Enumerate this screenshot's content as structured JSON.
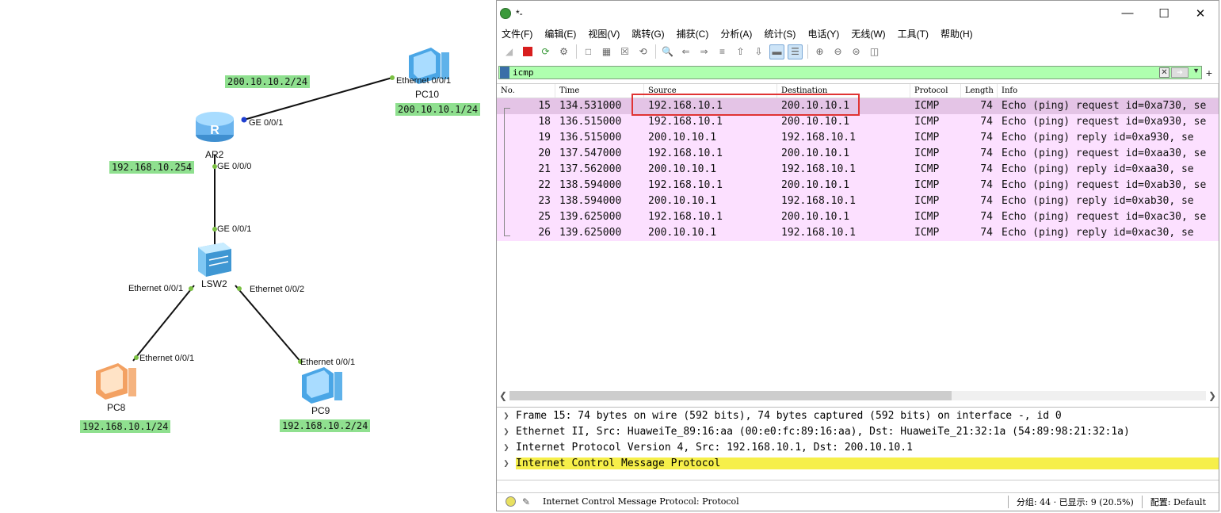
{
  "topology": {
    "ip_labels": {
      "ar2_wan": "200.10.10.2/24",
      "pc10": "200.10.10.1/24",
      "ar2_lan": "192.168.10.254",
      "pc8": "192.168.10.1/24",
      "pc9": "192.168.10.2/24"
    },
    "port_labels": {
      "pc10_eth": "Ethernet 0/0/1",
      "ar2_ge001": "GE 0/0/1",
      "ar2_ge000": "GE 0/0/0",
      "lsw2_ge001": "GE 0/0/1",
      "lsw2_eth1": "Ethernet 0/0/1",
      "lsw2_eth2": "Ethernet 0/0/2",
      "pc8_eth": "Ethernet 0/0/1",
      "pc9_eth": "Ethernet 0/0/1"
    },
    "devices": {
      "router": "AR2",
      "switch": "LSW2",
      "pc10": "PC10",
      "pc8": "PC8",
      "pc9": "PC9"
    },
    "colors": {
      "ip_label_bg": "#8fe08f",
      "link": "#111111",
      "port_dot": "#7bc043",
      "router_port_dot": "#1f3fd0"
    }
  },
  "wireshark": {
    "title": "*-",
    "menu": [
      "文件(F)",
      "编辑(E)",
      "视图(V)",
      "跳转(G)",
      "捕获(C)",
      "分析(A)",
      "统计(S)",
      "电话(Y)",
      "无线(W)",
      "工具(T)",
      "帮助(H)"
    ],
    "filter": {
      "value": "icmp"
    },
    "columns": [
      "No.",
      "Time",
      "Source",
      "Destination",
      "Protocol",
      "Length",
      "Info"
    ],
    "packets": [
      {
        "no": "15",
        "time": "134.531000",
        "src": "192.168.10.1",
        "dst": "200.10.10.1",
        "proto": "ICMP",
        "len": "74",
        "info": "Echo (ping) request  id=0xa730, se"
      },
      {
        "no": "18",
        "time": "136.515000",
        "src": "192.168.10.1",
        "dst": "200.10.10.1",
        "proto": "ICMP",
        "len": "74",
        "info": "Echo (ping) request  id=0xa930, se"
      },
      {
        "no": "19",
        "time": "136.515000",
        "src": "200.10.10.1",
        "dst": "192.168.10.1",
        "proto": "ICMP",
        "len": "74",
        "info": "Echo (ping) reply    id=0xa930, se"
      },
      {
        "no": "20",
        "time": "137.547000",
        "src": "192.168.10.1",
        "dst": "200.10.10.1",
        "proto": "ICMP",
        "len": "74",
        "info": "Echo (ping) request  id=0xaa30, se"
      },
      {
        "no": "21",
        "time": "137.562000",
        "src": "200.10.10.1",
        "dst": "192.168.10.1",
        "proto": "ICMP",
        "len": "74",
        "info": "Echo (ping) reply    id=0xaa30, se"
      },
      {
        "no": "22",
        "time": "138.594000",
        "src": "192.168.10.1",
        "dst": "200.10.10.1",
        "proto": "ICMP",
        "len": "74",
        "info": "Echo (ping) request  id=0xab30, se"
      },
      {
        "no": "23",
        "time": "138.594000",
        "src": "200.10.10.1",
        "dst": "192.168.10.1",
        "proto": "ICMP",
        "len": "74",
        "info": "Echo (ping) reply    id=0xab30, se"
      },
      {
        "no": "25",
        "time": "139.625000",
        "src": "192.168.10.1",
        "dst": "200.10.10.1",
        "proto": "ICMP",
        "len": "74",
        "info": "Echo (ping) request  id=0xac30, se"
      },
      {
        "no": "26",
        "time": "139.625000",
        "src": "200.10.10.1",
        "dst": "192.168.10.1",
        "proto": "ICMP",
        "len": "74",
        "info": "Echo (ping) reply    id=0xac30, se"
      }
    ],
    "details": [
      "Frame 15: 74 bytes on wire (592 bits), 74 bytes captured (592 bits) on interface -, id 0",
      "Ethernet II, Src: HuaweiTe_89:16:aa (00:e0:fc:89:16:aa), Dst: HuaweiTe_21:32:1a (54:89:98:21:32:1a)",
      "Internet Protocol Version 4, Src: 192.168.10.1, Dst: 200.10.10.1",
      "Internet Control Message Protocol"
    ],
    "status": {
      "message": "Internet Control Message Protocol: Protocol",
      "packets": "分组: 44 · 已显示: 9 (20.5%)",
      "profile": "配置: Default"
    },
    "colors": {
      "row_bg": "#fce0ff",
      "row_selected": "#e4c4e6",
      "filter_bg": "#afffaf",
      "highlight": "#f6ef4a",
      "annotation": "#e03434"
    }
  }
}
